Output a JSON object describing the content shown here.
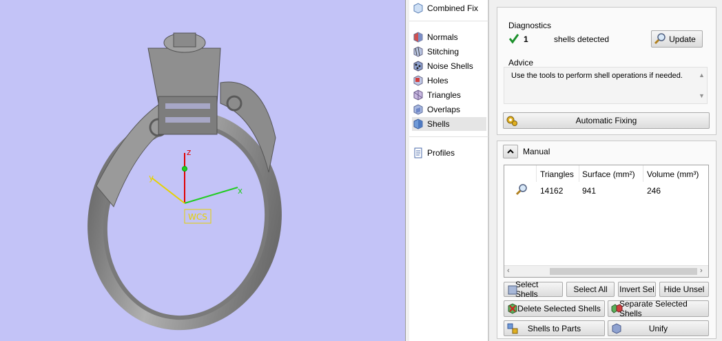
{
  "viewport": {
    "axes": {
      "z_label": "z",
      "x_label": "x",
      "y_label": "y",
      "wcs_label": "WCS"
    },
    "colors": {
      "background": "#c3c3f7",
      "model": "#8a8a8a"
    }
  },
  "tree": {
    "top_item": {
      "label": "Combined Fix",
      "icon": "combined-fix-icon"
    },
    "items": [
      {
        "label": "Normals",
        "icon": "normals-icon"
      },
      {
        "label": "Stitching",
        "icon": "stitching-icon"
      },
      {
        "label": "Noise Shells",
        "icon": "noise-shells-icon"
      },
      {
        "label": "Holes",
        "icon": "holes-icon"
      },
      {
        "label": "Triangles",
        "icon": "triangles-icon"
      },
      {
        "label": "Overlaps",
        "icon": "overlaps-icon"
      },
      {
        "label": "Shells",
        "icon": "shells-icon",
        "selected": true
      }
    ],
    "profiles": {
      "label": "Profiles",
      "icon": "profiles-icon"
    }
  },
  "diagnostics": {
    "title": "Diagnostics",
    "count": "1",
    "status_text": "shells detected",
    "update_label": "Update"
  },
  "advice": {
    "title": "Advice",
    "text": "Use the tools to perform shell operations if needed."
  },
  "automatic_fixing": {
    "label": "Automatic Fixing"
  },
  "manual": {
    "title": "Manual",
    "table": {
      "headers": [
        "Triangles",
        "Surface (mm²)",
        "Volume (mm³)"
      ],
      "rows": [
        {
          "triangles": "14162",
          "surface": "941",
          "volume": "246"
        }
      ]
    },
    "buttons": {
      "select_shells": "Select Shells",
      "select_all": "Select All",
      "invert_sel": "Invert Sel",
      "hide_unsel": "Hide Unsel",
      "delete_selected": "Delete Selected Shells",
      "separate_selected": "Separate Selected Shells",
      "shells_to_parts": "Shells to Parts",
      "unify": "Unify"
    }
  }
}
